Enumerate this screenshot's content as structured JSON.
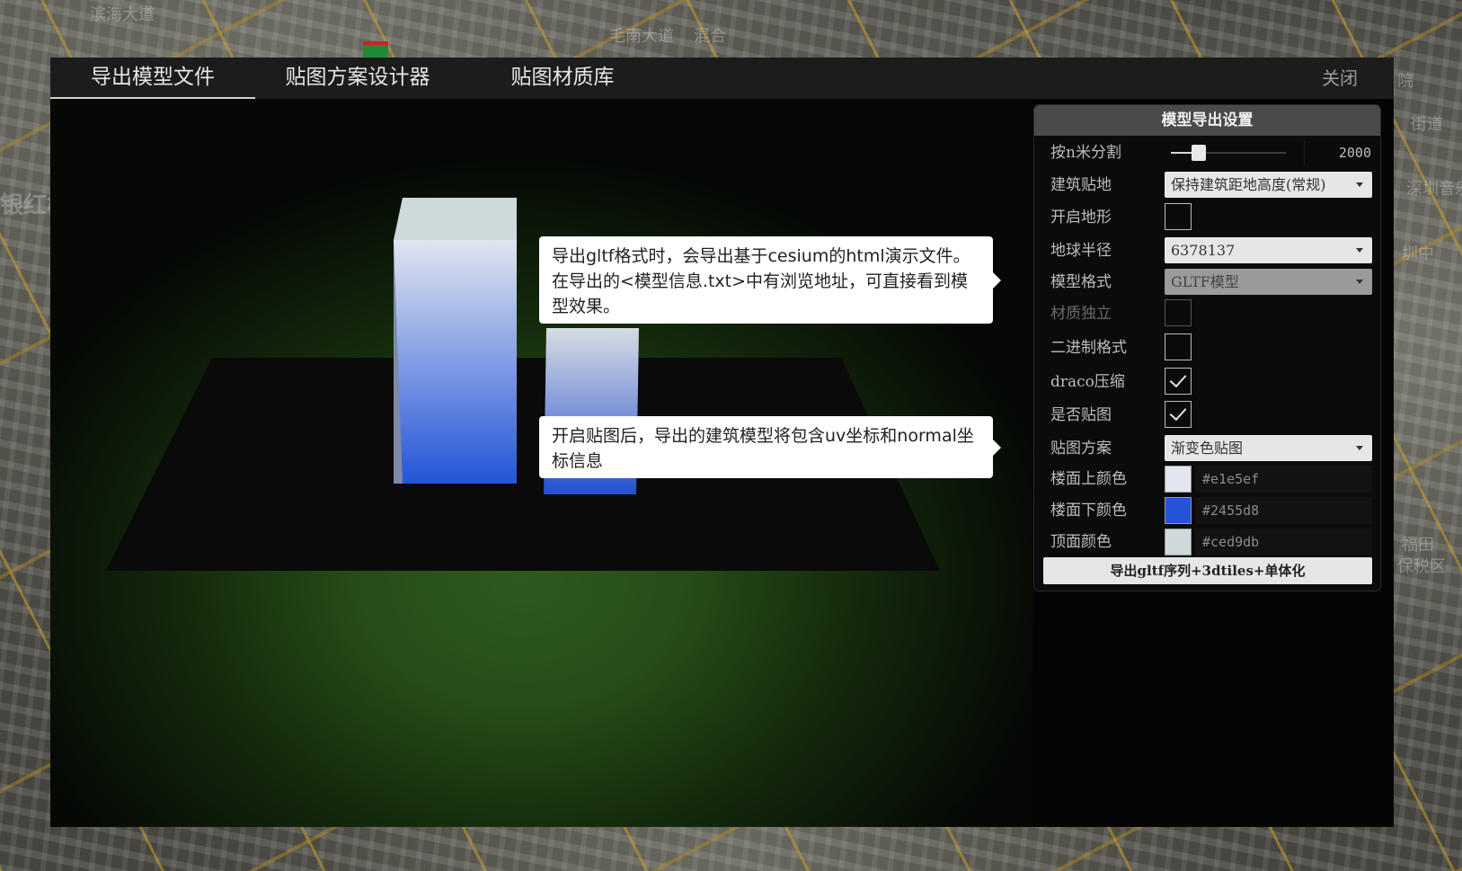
{
  "map": {
    "labels": [
      "滨海大道",
      "毛南大道",
      "混合",
      "银红树",
      "院",
      "街道",
      "深圳音乐",
      "圳中",
      "福田",
      "保税区"
    ],
    "sign": "G"
  },
  "tabs": [
    {
      "label": "导出模型文件",
      "active": true
    },
    {
      "label": "贴图方案设计器",
      "active": false
    },
    {
      "label": "贴图材质库",
      "active": false
    }
  ],
  "close_label": "关闭",
  "tooltips": {
    "gltf": "导出gltf格式时，会导出基于cesium的html演示文件。在导出的<模型信息.txt>中有浏览地址，可直接看到模型效果。",
    "texture": "开启贴图后，导出的建筑模型将包含uv坐标和normal坐标信息"
  },
  "panel": {
    "title": "模型导出设置",
    "split": {
      "label": "按n米分割",
      "value": "2000",
      "level": 0.18
    },
    "ground": {
      "label": "建筑贴地",
      "value": "保持建筑距地高度(常规)"
    },
    "terrain": {
      "label": "开启地形",
      "checked": false
    },
    "radius": {
      "label": "地球半径",
      "value": "6378137"
    },
    "format": {
      "label": "模型格式",
      "value": "GLTF模型",
      "disabled": true
    },
    "material": {
      "label": "材质独立",
      "checked": false,
      "disabled": true
    },
    "binary": {
      "label": "二进制格式",
      "checked": false
    },
    "draco": {
      "label": "draco压缩",
      "checked": true
    },
    "texture": {
      "label": "是否贴图",
      "checked": true
    },
    "scheme": {
      "label": "贴图方案",
      "value": "渐变色贴图"
    },
    "top_color": {
      "label": "楼面上颜色",
      "value": "#e1e5ef"
    },
    "bottom_color": {
      "label": "楼面下颜色",
      "value": "#2455d8"
    },
    "roof_color": {
      "label": "顶面颜色",
      "value": "#ced9db"
    },
    "export_label": "导出gltf序列+3dtiles+单体化"
  },
  "colors": {
    "top": "#e1e5ef",
    "bottom": "#2455d8",
    "roof": "#ced9db"
  }
}
